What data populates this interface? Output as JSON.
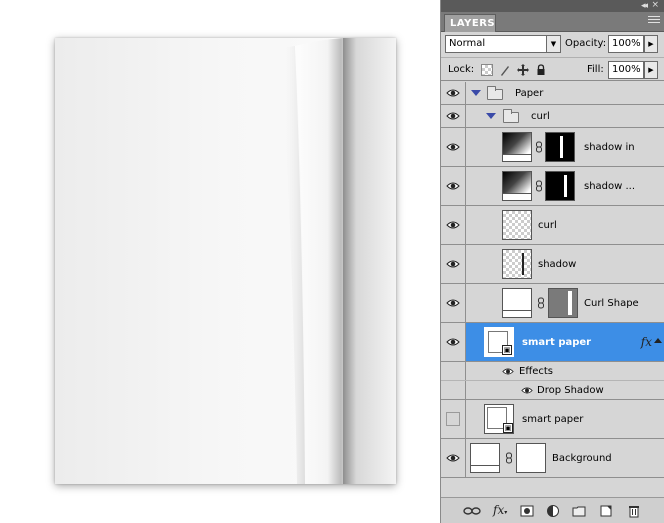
{
  "panel": {
    "tab_label": "LAYERS",
    "blend_mode": "Normal",
    "opacity_label": "Opacity:",
    "opacity_value": "100%",
    "lock_label": "Lock:",
    "fill_label": "Fill:",
    "fill_value": "100%"
  },
  "layers": [
    {
      "name": "Paper",
      "kind": "group",
      "visible": true
    },
    {
      "name": "curl",
      "kind": "group",
      "visible": true
    },
    {
      "name": "shadow in",
      "kind": "layer-with-mask",
      "visible": true
    },
    {
      "name": "shadow ...",
      "kind": "layer-with-mask",
      "visible": true
    },
    {
      "name": "curl",
      "kind": "layer",
      "visible": true
    },
    {
      "name": "shadow",
      "kind": "layer",
      "visible": true
    },
    {
      "name": "Curl Shape",
      "kind": "layer-with-mask",
      "visible": true
    },
    {
      "name": "smart paper",
      "kind": "smart-object",
      "visible": true,
      "selected": true
    },
    {
      "name": "Effects",
      "kind": "effects-header",
      "visible": true
    },
    {
      "name": "Drop Shadow",
      "kind": "effect",
      "visible": true
    },
    {
      "name": "smart paper",
      "kind": "smart-object",
      "visible": false
    },
    {
      "name": "Background",
      "kind": "layer-with-mask",
      "visible": true
    }
  ],
  "colors": {
    "selection": "#3d8ee6",
    "panel_bg": "#d6d6d6",
    "tab_bar": "#7a7a7a"
  },
  "icons": [
    "eye-icon",
    "folder-icon",
    "chain-link-icon",
    "fx-icon",
    "lock-transparent-icon",
    "lock-brush-icon",
    "lock-move-icon",
    "lock-all-icon",
    "panel-menu-icon",
    "collapse-icon",
    "close-icon",
    "link-layers-icon",
    "add-style-icon",
    "add-mask-icon",
    "adjustment-layer-icon",
    "new-group-icon",
    "new-layer-icon",
    "delete-layer-icon"
  ]
}
